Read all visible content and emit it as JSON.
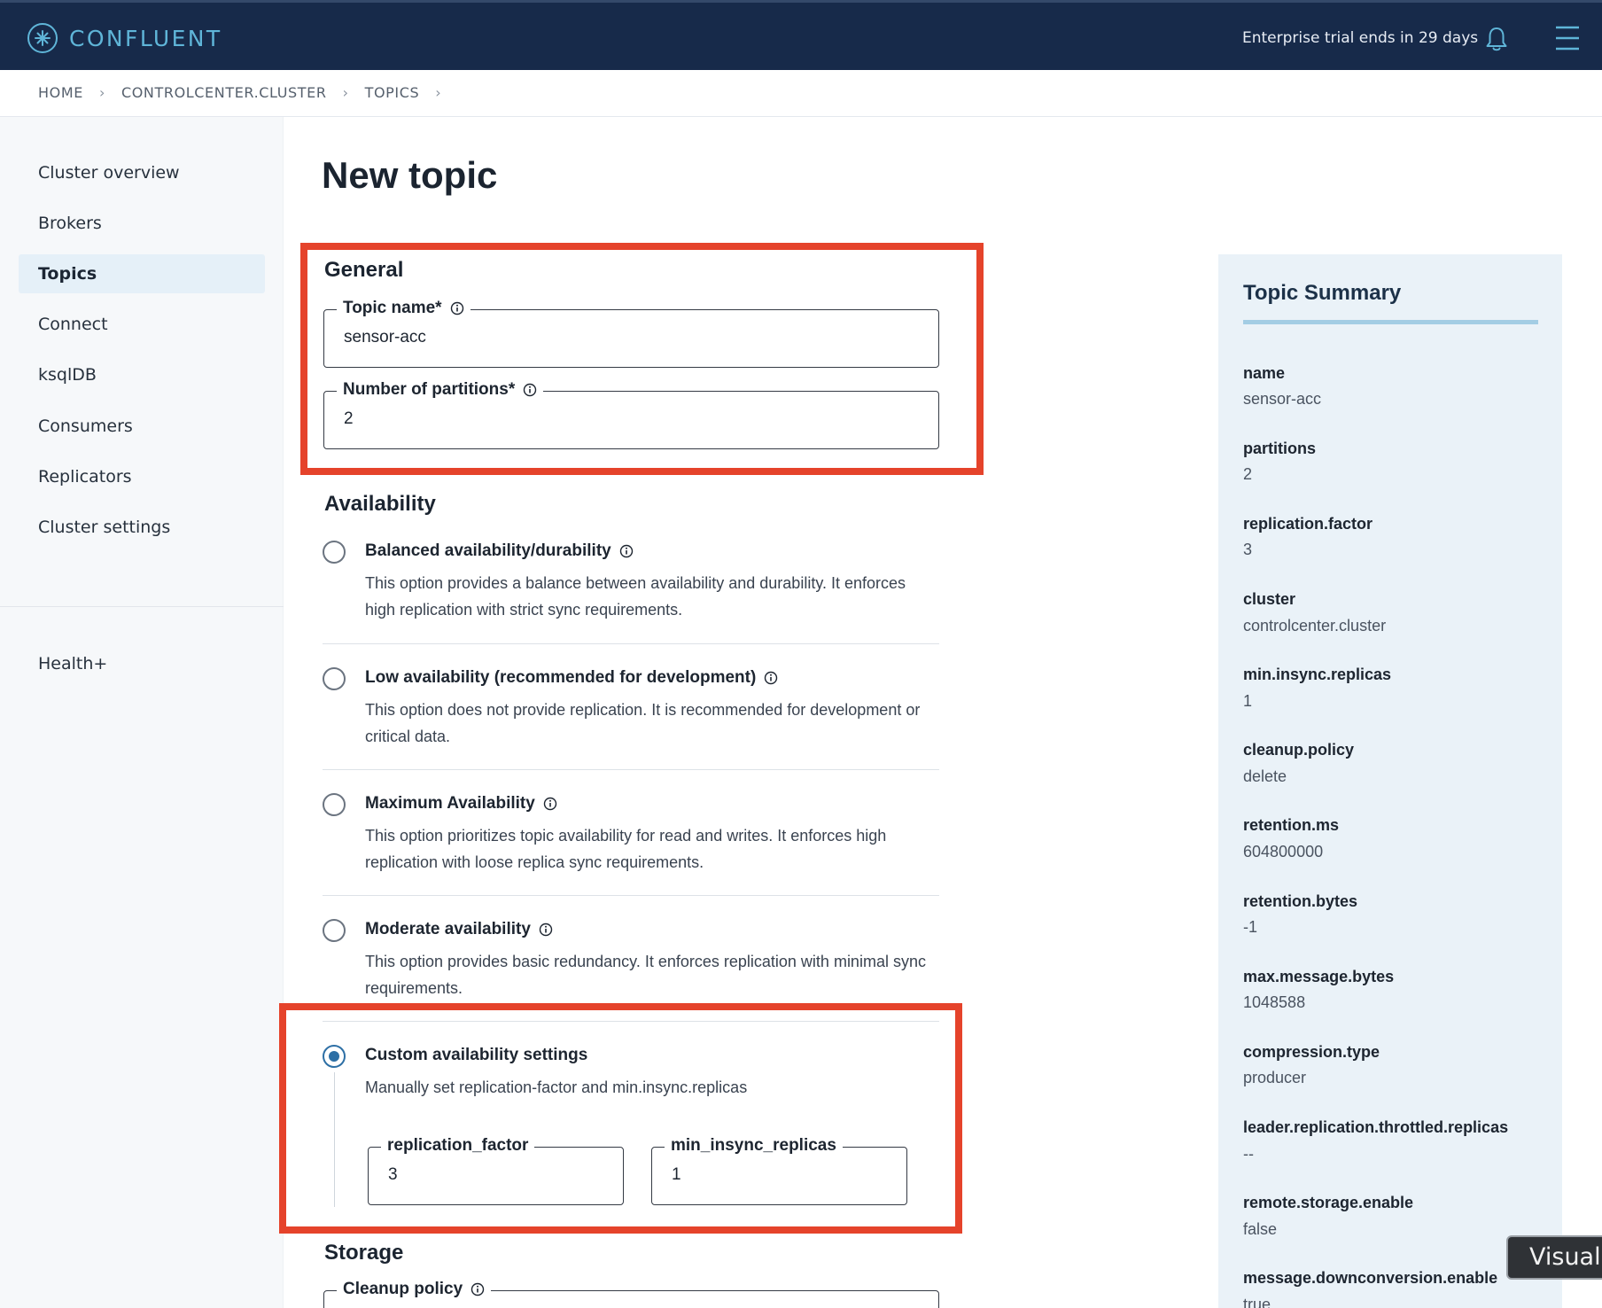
{
  "header": {
    "logo_text": "CONFLUENT",
    "trial_text": "Enterprise trial ends in 29 days",
    "bell_icon": "bell-icon",
    "menu_icon": "hamburger-menu-icon"
  },
  "breadcrumb": {
    "items": [
      "HOME",
      "CONTROLCENTER.CLUSTER",
      "TOPICS"
    ],
    "separator": "›"
  },
  "sidebar": {
    "items": [
      {
        "label": "Cluster overview",
        "active": false
      },
      {
        "label": "Brokers",
        "active": false
      },
      {
        "label": "Topics",
        "active": true
      },
      {
        "label": "Connect",
        "active": false
      },
      {
        "label": "ksqlDB",
        "active": false
      },
      {
        "label": "Consumers",
        "active": false
      },
      {
        "label": "Replicators",
        "active": false
      },
      {
        "label": "Cluster settings",
        "active": false
      }
    ],
    "secondary": [
      {
        "label": "Health+",
        "active": false
      }
    ]
  },
  "page": {
    "title": "New topic"
  },
  "general": {
    "heading": "General",
    "topic_name": {
      "label": "Topic name*",
      "value": "sensor-acc"
    },
    "partitions": {
      "label": "Number of partitions*",
      "value": "2"
    }
  },
  "availability": {
    "heading": "Availability",
    "options": [
      {
        "title": "Balanced availability/durability",
        "desc": "This option provides a balance between availability and durability. It enforces high replication with strict sync requirements.",
        "selected": false
      },
      {
        "title": "Low availability (recommended for development)",
        "desc": "This option does not provide replication. It is recommended for development or critical data.",
        "selected": false
      },
      {
        "title": "Maximum Availability",
        "desc": "This option prioritizes topic availability for read and writes. It enforces high replication with loose replica sync requirements.",
        "selected": false
      },
      {
        "title": "Moderate availability",
        "desc": "This option provides basic redundancy. It enforces replication with minimal sync requirements.",
        "selected": false
      },
      {
        "title": "Custom availability settings",
        "desc": "Manually set replication-factor and min.insync.replicas",
        "selected": true
      }
    ],
    "custom": {
      "replication_factor": {
        "label": "replication_factor",
        "value": "3"
      },
      "min_insync_replicas": {
        "label": "min_insync_replicas",
        "value": "1"
      }
    }
  },
  "storage": {
    "heading": "Storage",
    "cleanup_policy_label": "Cleanup policy"
  },
  "summary": {
    "title": "Topic Summary",
    "entries": [
      {
        "key": "name",
        "value": "sensor-acc"
      },
      {
        "key": "partitions",
        "value": "2"
      },
      {
        "key": "replication.factor",
        "value": "3"
      },
      {
        "key": "cluster",
        "value": "controlcenter.cluster"
      },
      {
        "key": "min.insync.replicas",
        "value": "1"
      },
      {
        "key": "cleanup.policy",
        "value": "delete"
      },
      {
        "key": "retention.ms",
        "value": "604800000"
      },
      {
        "key": "retention.bytes",
        "value": "-1"
      },
      {
        "key": "max.message.bytes",
        "value": "1048588"
      },
      {
        "key": "compression.type",
        "value": "producer"
      },
      {
        "key": "leader.replication.throttled.replicas",
        "value": "--"
      },
      {
        "key": "remote.storage.enable",
        "value": "false"
      },
      {
        "key": "message.downconversion.enable",
        "value": "true"
      }
    ]
  },
  "floating": {
    "visual_label": "Visual"
  },
  "colors": {
    "header_bg": "#172a4a",
    "logo": "#5fb5d8",
    "highlight_box": "#e5432b",
    "radio_selected": "#2d6fa5",
    "summary_bg": "#eaf2f8"
  }
}
